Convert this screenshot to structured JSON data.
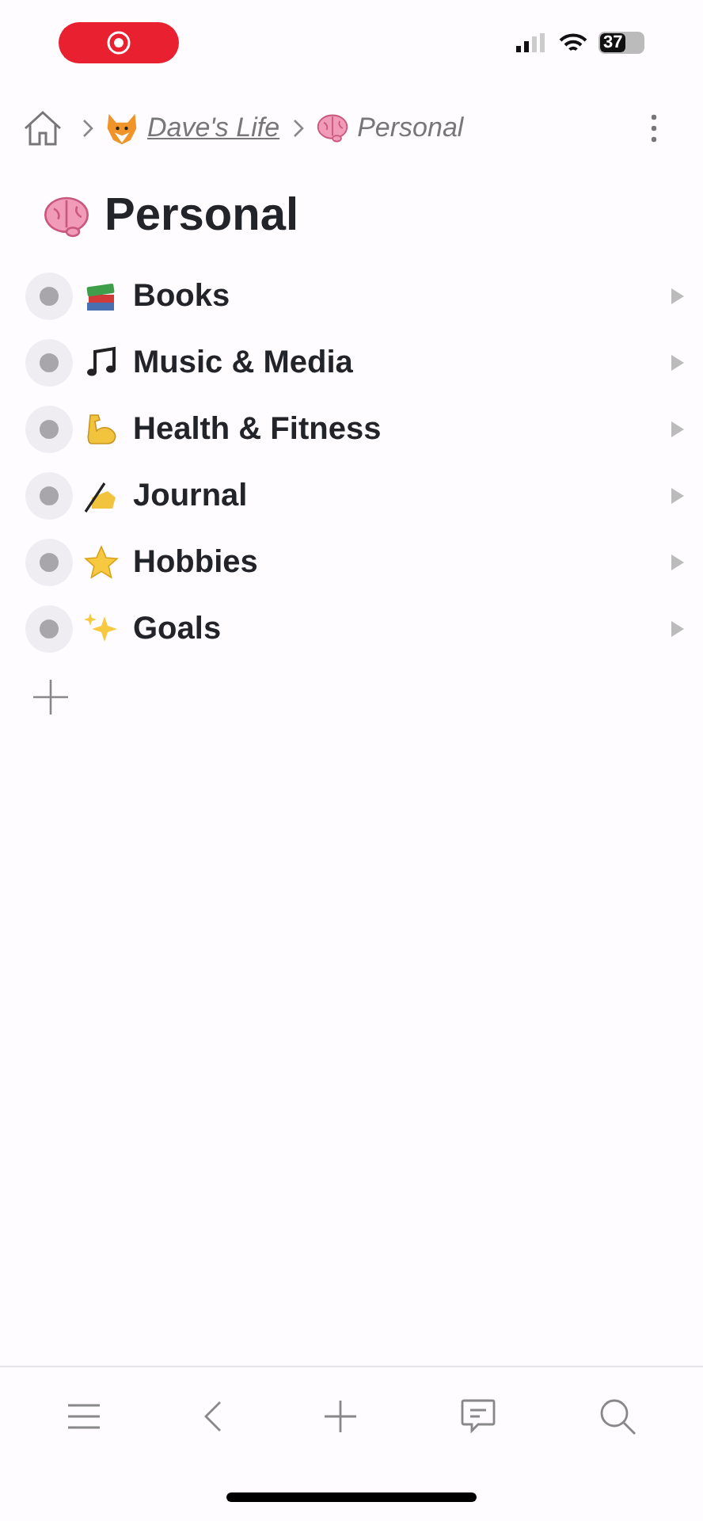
{
  "status_bar": {
    "battery": "37"
  },
  "breadcrumb": [
    {
      "kind": "fox",
      "label": "Dave's Life",
      "link": true
    },
    {
      "kind": "brain",
      "label": "Personal",
      "link": false
    }
  ],
  "page": {
    "kind": "brain",
    "title": "Personal"
  },
  "items": [
    {
      "kind": "books",
      "label": "Books"
    },
    {
      "kind": "music",
      "label": "Music & Media"
    },
    {
      "kind": "muscle",
      "label": "Health & Fitness"
    },
    {
      "kind": "writing",
      "label": "Journal"
    },
    {
      "kind": "star",
      "label": "Hobbies"
    },
    {
      "kind": "sparkles",
      "label": "Goals"
    }
  ]
}
